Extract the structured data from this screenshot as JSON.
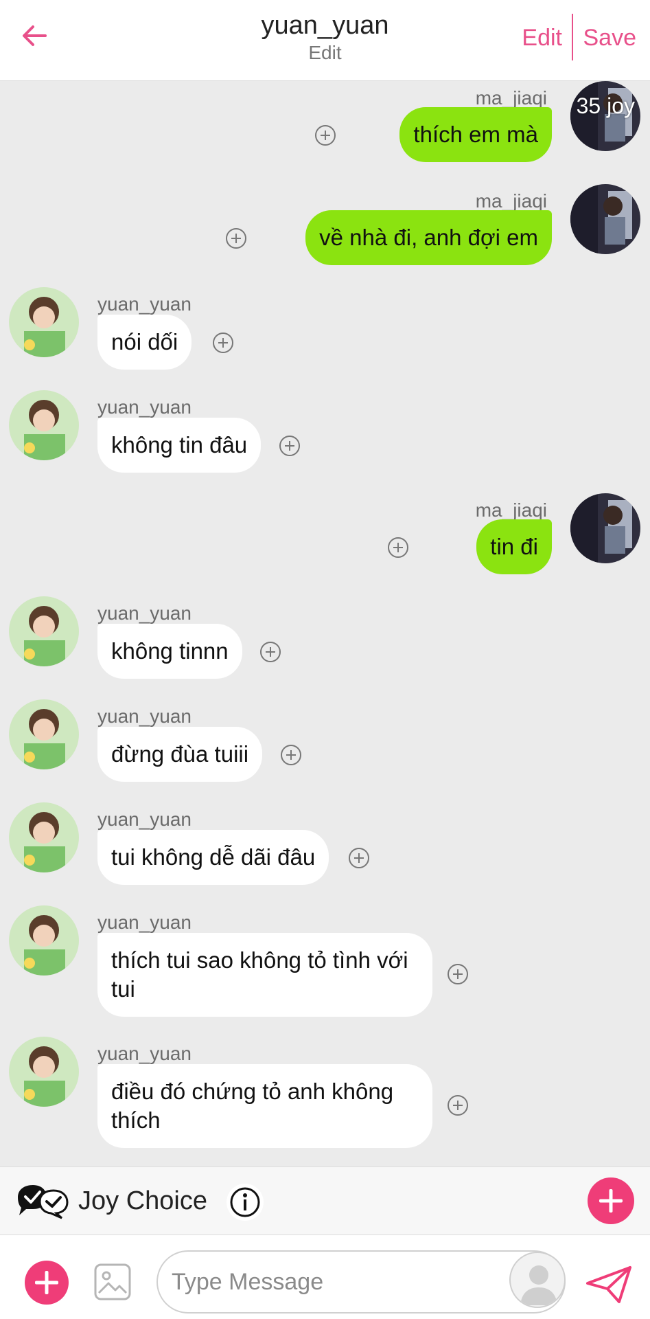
{
  "header": {
    "title": "yuan_yuan",
    "subtitle": "Edit",
    "edit_label": "Edit",
    "save_label": "Save",
    "accent_color": "#e8508a"
  },
  "badge": "35 joy",
  "messages": [
    {
      "side": "right",
      "sender": "ma_jiaqi",
      "text": "thích em mà"
    },
    {
      "side": "right",
      "sender": "ma_jiaqi",
      "text": "về nhà đi, anh đợi em"
    },
    {
      "side": "left",
      "sender": "yuan_yuan",
      "text": "nói dối"
    },
    {
      "side": "left",
      "sender": "yuan_yuan",
      "text": "không tin đâu"
    },
    {
      "side": "right",
      "sender": "ma_jiaqi",
      "text": "tin đi"
    },
    {
      "side": "left",
      "sender": "yuan_yuan",
      "text": "không tinnn"
    },
    {
      "side": "left",
      "sender": "yuan_yuan",
      "text": "đừng đùa tuiii"
    },
    {
      "side": "left",
      "sender": "yuan_yuan",
      "text": "tui không dễ dãi đâu"
    },
    {
      "side": "left",
      "sender": "yuan_yuan",
      "text": "thích tui sao không tỏ tình với tui"
    },
    {
      "side": "left",
      "sender": "yuan_yuan",
      "text": "điều đó chứng tỏ anh không thích"
    }
  ],
  "joy_choice": {
    "label": "Joy Choice"
  },
  "composer": {
    "placeholder": "Type Message"
  },
  "colors": {
    "sent_bubble": "#8be310",
    "received_bubble": "#ffffff",
    "chat_background": "#ebebeb",
    "plus_button": "#ef3d78"
  },
  "icons": [
    "back-arrow-icon",
    "add-reaction-icon",
    "joy-choice-icon",
    "info-icon",
    "plus-icon",
    "image-icon",
    "persona-icon",
    "send-icon"
  ]
}
